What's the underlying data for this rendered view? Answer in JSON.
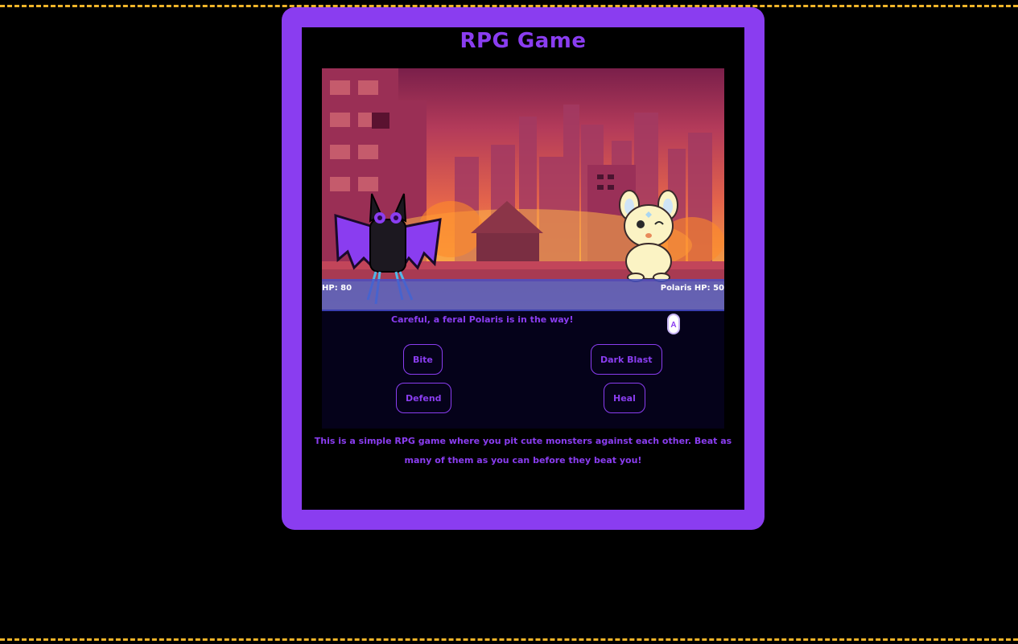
{
  "game": {
    "title": "RPG Game",
    "player_hp_label": "HP: 80",
    "enemy_hp_label": "Polaris HP: 50",
    "message": "Careful, a feral Polaris is in the way!",
    "action_button_label": "A",
    "moves": {
      "bite": "Bite",
      "dark_blast": "Dark Blast",
      "defend": "Defend",
      "heal": "Heal"
    },
    "description": "This is a simple RPG game where you pit cute monsters against each other. Beat as many of them as you can before they beat you!"
  },
  "sprites": {
    "background": "burning-city-background",
    "player": "purple-bat-monster-sprite",
    "enemy": "cream-bunny-polaris-sprite"
  },
  "colors": {
    "accent": "#8a3df0",
    "border_dash": "#f0b429",
    "hp_bar": "#4650c8",
    "panel": "#05021a"
  }
}
